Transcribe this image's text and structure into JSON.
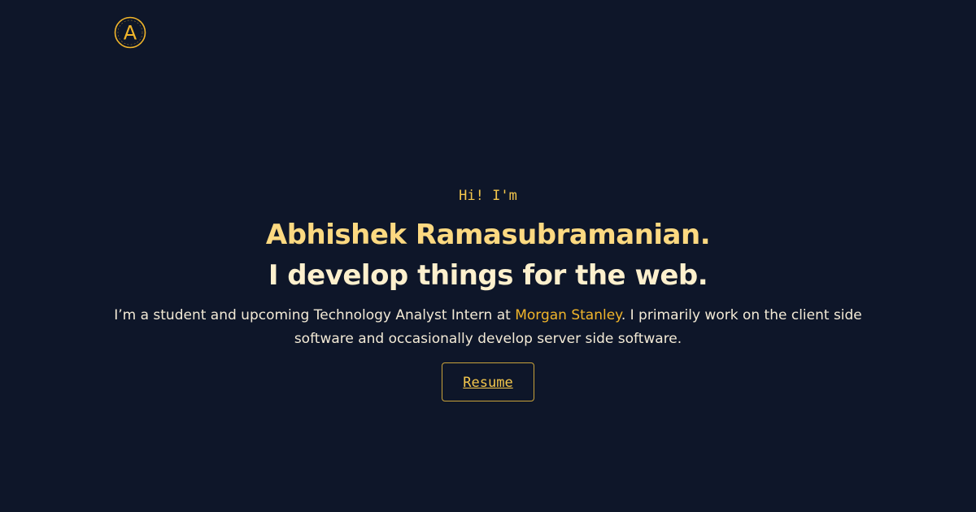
{
  "logo": {
    "icon": "circle-a-logo-icon",
    "letter": "A",
    "color": "#f1b52a"
  },
  "hero": {
    "greeting": "Hi! I'm",
    "name": "Abhishek Ramasubramanian.",
    "tagline": "I develop things for the web.",
    "bio_before": "I’m a student and upcoming Technology Analyst Intern at ",
    "bio_link": "Morgan Stanley",
    "bio_after": ". I primarily work on the client side software and occasionally develop server side software.",
    "resume_label": "Resume"
  },
  "colors": {
    "background": "#0e1629",
    "accent": "#f1b52a",
    "name": "#fcd981",
    "tagline": "#fdf0cd",
    "body_text": "#f3ead6"
  }
}
